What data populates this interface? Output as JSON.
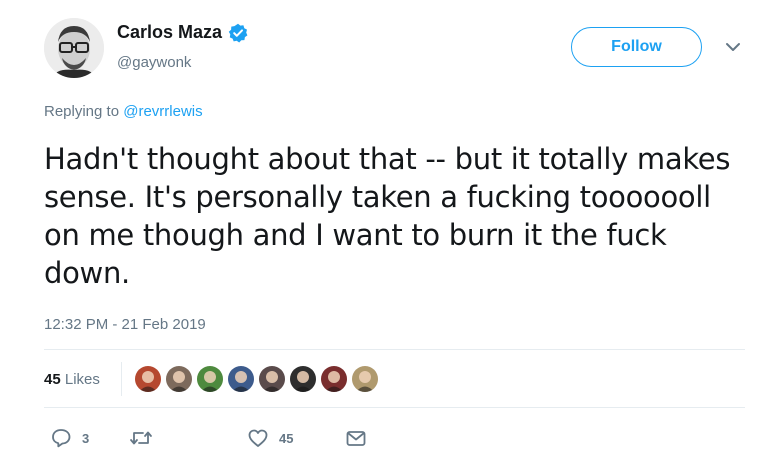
{
  "author": {
    "display_name": "Carlos Maza",
    "handle": "@gaywonk",
    "verified": true
  },
  "follow": {
    "label": "Follow"
  },
  "reply_context": {
    "prefix": "Replying to ",
    "handle": "@revrrlewis"
  },
  "tweet": {
    "text": "Hadn't thought about that -- but it totally makes sense. It's personally taken a fucking tooooooll on me though and I want to burn it the fuck down.",
    "timestamp": "12:32 PM - 21 Feb 2019"
  },
  "stats": {
    "likes_count": "45",
    "likes_label": "Likes",
    "likers": [
      {
        "name": "liker-1",
        "color": "#b5482f"
      },
      {
        "name": "liker-2",
        "color": "#7d6a5c"
      },
      {
        "name": "liker-3",
        "color": "#4e8a3e"
      },
      {
        "name": "liker-4",
        "color": "#3d5b8c"
      },
      {
        "name": "liker-5",
        "color": "#5a4b4b"
      },
      {
        "name": "liker-6",
        "color": "#2e2e2e"
      },
      {
        "name": "liker-7",
        "color": "#7a2e2e"
      },
      {
        "name": "liker-8",
        "color": "#b09a6e"
      }
    ]
  },
  "actions": {
    "reply_count": "3",
    "retweet_count": "",
    "like_count": "45"
  },
  "colors": {
    "accent": "#1da1f2",
    "secondary_text": "#657786",
    "primary_text": "#14171a",
    "divider": "#e6ecf0"
  },
  "icons": {
    "reply": "reply-icon",
    "retweet": "retweet-icon",
    "like": "heart-icon",
    "dm": "envelope-icon",
    "verified": "verified-badge-icon",
    "more": "chevron-down-icon"
  }
}
